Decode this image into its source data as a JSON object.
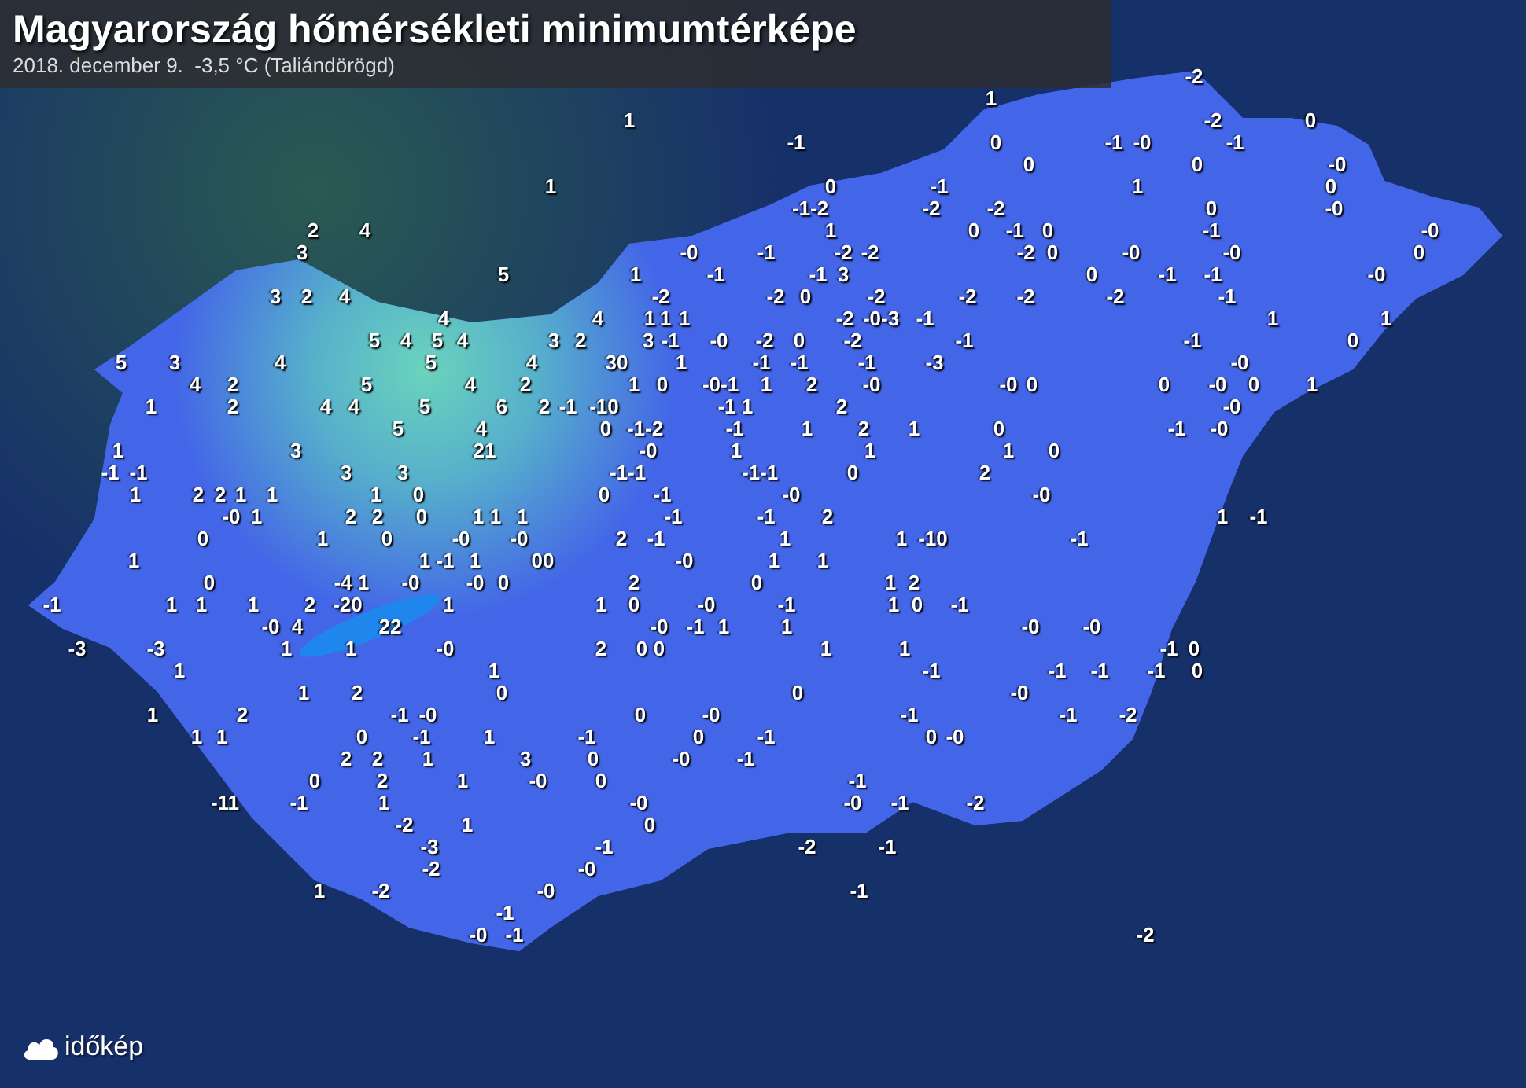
{
  "title": {
    "heading": "Magyarország hőmérsékleti minimumtérképe",
    "subtitle": "2018. december 9.  -3,5 °C (Taliándörögd)"
  },
  "map": {
    "readings": [
      "-2",
      "1",
      "1",
      "-2",
      "0",
      "-1",
      "0",
      "-1",
      "-0",
      "-1",
      "0",
      "0",
      "-0",
      "1",
      "0",
      "-1",
      "1",
      "0",
      "-1-2",
      "-2",
      "-2",
      "0",
      "-0",
      "2",
      "4",
      "1",
      "0",
      "-1",
      "0",
      "-1",
      "-0",
      "3",
      "-0",
      "-1",
      "-2",
      "-2",
      "-2",
      "0",
      "-0",
      "-0",
      "0",
      "5",
      "1",
      "-1",
      "-1",
      "3",
      "0",
      "-1",
      "-1",
      "-0",
      "3",
      "2",
      "4",
      "-2",
      "-2",
      "0",
      "-2",
      "-2",
      "-2",
      "-2",
      "-1",
      "4",
      "4",
      "1",
      "1",
      "1",
      "-2",
      "-0-3",
      "-1",
      "1",
      "1",
      "5",
      "4",
      "5",
      "4",
      "3",
      "2",
      "3",
      "-1",
      "-0",
      "-2",
      "0",
      "-2",
      "-1",
      "-1",
      "0",
      "5",
      "3",
      "4",
      "5",
      "4",
      "30",
      "1",
      "-1",
      "-1",
      "-1",
      "-3",
      "-0",
      "4",
      "2",
      "5",
      "4",
      "2",
      "1",
      "0",
      "-0-1",
      "1",
      "2",
      "-0",
      "-0",
      "0",
      "0",
      "-0",
      "0",
      "1",
      "1",
      "2",
      "4",
      "4",
      "5",
      "6",
      "2",
      "-1",
      "-10",
      "-1",
      "1",
      "2",
      "-0",
      "5",
      "4",
      "0",
      "-1-2",
      "-1",
      "1",
      "2",
      "1",
      "0",
      "-1",
      "-0",
      "1",
      "3",
      "21",
      "-0",
      "1",
      "1",
      "1",
      "0",
      "-1",
      "-1",
      "3",
      "3",
      "-1-1",
      "-1-1",
      "0",
      "2",
      "1",
      "2",
      "2",
      "1",
      "1",
      "1",
      "0",
      "0",
      "-1",
      "-0",
      "-0",
      "-0",
      "1",
      "2",
      "2",
      "0",
      "1",
      "1",
      "1",
      "-1",
      "-1",
      "2",
      "1",
      "-1",
      "0",
      "1",
      "0",
      "-0",
      "-0",
      "2",
      "-1",
      "1",
      "1",
      "-10",
      "-1",
      "1",
      "1",
      "-1",
      "1",
      "00",
      "-0",
      "1",
      "1",
      "0",
      "-4",
      "1",
      "-0",
      "-0",
      "0",
      "2",
      "0",
      "1",
      "2",
      "-1",
      "1",
      "1",
      "1",
      "2",
      "-20",
      "1",
      "1",
      "0",
      "-0",
      "-1",
      "1",
      "0",
      "-1",
      "-0",
      "4",
      "22",
      "-0",
      "-1",
      "1",
      "1",
      "-0",
      "-0",
      "-3",
      "-3",
      "1",
      "1",
      "-0",
      "2",
      "0",
      "0",
      "1",
      "1",
      "-1",
      "0",
      "1",
      "1",
      "-1",
      "-1",
      "-1",
      "-1",
      "0",
      "1",
      "2",
      "0",
      "0",
      "-0",
      "1",
      "2",
      "-1",
      "-0",
      "0",
      "-0",
      "-1",
      "-1",
      "-2",
      "1",
      "1",
      "0",
      "-1",
      "1",
      "-1",
      "0",
      "-1",
      "0",
      "-0",
      "2",
      "2",
      "1",
      "3",
      "0",
      "-0",
      "-1",
      "0",
      "2",
      "1",
      "-0",
      "0",
      "-1",
      "-11",
      "-1",
      "1",
      "-0",
      "-0",
      "-1",
      "-2",
      "-2",
      "1",
      "0",
      "-3",
      "-1",
      "-2",
      "-1",
      "-2",
      "-0",
      "1",
      "-2",
      "-0",
      "-1",
      "-1",
      "-0",
      "-1",
      "-2"
    ]
  },
  "logo": {
    "text": "időkép"
  }
}
